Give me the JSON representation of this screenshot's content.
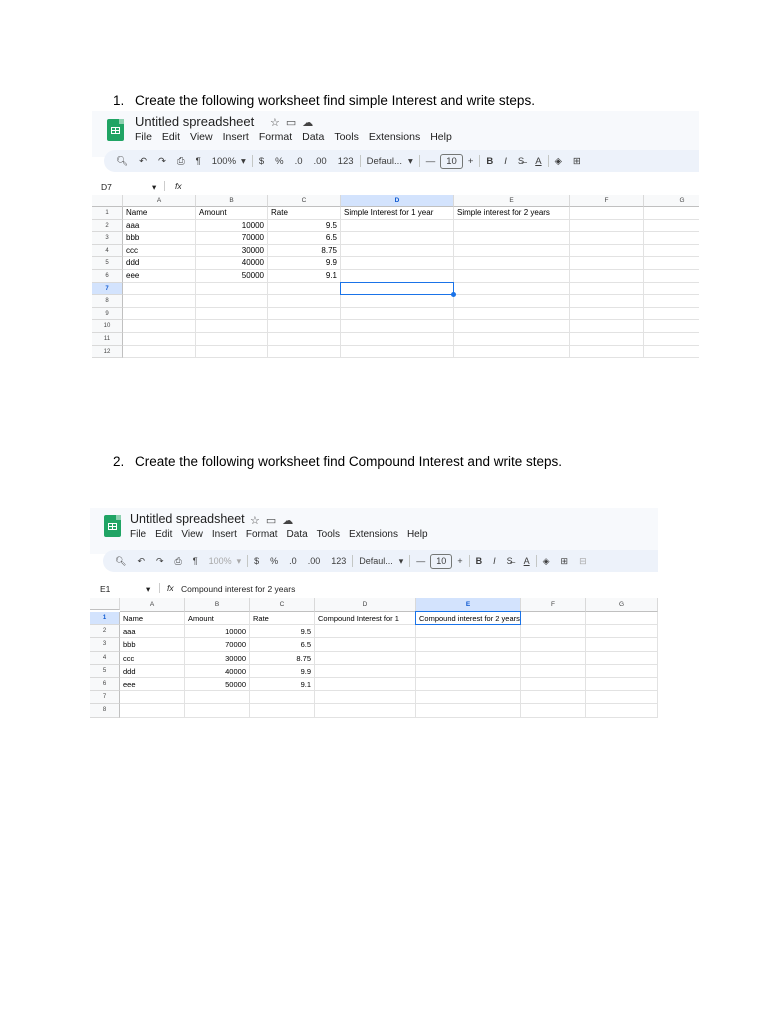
{
  "q1": {
    "number": "1.",
    "text": "Create the following worksheet find simple Interest and write steps."
  },
  "q2": {
    "number": "2.",
    "text": "Create the following worksheet find Compound Interest and write steps."
  },
  "sheet1": {
    "title": "Untitled spreadsheet",
    "menu": [
      "File",
      "Edit",
      "View",
      "Insert",
      "Format",
      "Data",
      "Tools",
      "Extensions",
      "Help"
    ],
    "toolbar": {
      "zoom": "100%",
      "currency": "$",
      "percent": "%",
      "dec_down": ".0",
      "dec_up": ".00",
      "format": "123",
      "font": "Defaul...",
      "size": "10",
      "minus": "—",
      "plus": "+"
    },
    "name_box": "D7",
    "fx": "fx",
    "formula": "",
    "columns": [
      "A",
      "B",
      "C",
      "D",
      "E",
      "F",
      "G"
    ],
    "rows": [
      "1",
      "2",
      "3",
      "4",
      "5",
      "6",
      "7",
      "8",
      "9",
      "10",
      "11",
      "12"
    ],
    "selected_col": "D",
    "selected_row": "7",
    "cells": [
      [
        "Name",
        "Amount",
        "Rate",
        "Simple Interest for 1 year",
        "Simple interest for 2 years",
        "",
        ""
      ],
      [
        "aaa",
        "10000",
        "9.5",
        "",
        "",
        "",
        ""
      ],
      [
        "bbb",
        "70000",
        "6.5",
        "",
        "",
        "",
        ""
      ],
      [
        "ccc",
        "30000",
        "8.75",
        "",
        "",
        "",
        ""
      ],
      [
        "ddd",
        "40000",
        "9.9",
        "",
        "",
        "",
        ""
      ],
      [
        "eee",
        "50000",
        "9.1",
        "",
        "",
        "",
        ""
      ]
    ]
  },
  "sheet2": {
    "title": "Untitled spreadsheet",
    "menu": [
      "File",
      "Edit",
      "View",
      "Insert",
      "Format",
      "Data",
      "Tools",
      "Extensions",
      "Help"
    ],
    "toolbar": {
      "zoom": "100%",
      "currency": "$",
      "percent": "%",
      "dec_down": ".0",
      "dec_up": ".00",
      "format": "123",
      "font": "Defaul...",
      "size": "10",
      "minus": "—",
      "plus": "+"
    },
    "name_box": "E1",
    "fx": "fx",
    "formula": "Compound interest for 2 years",
    "columns": [
      "A",
      "B",
      "C",
      "D",
      "E",
      "F",
      "G"
    ],
    "rows": [
      "1",
      "2",
      "3",
      "4",
      "5",
      "6",
      "7",
      "8"
    ],
    "selected_col": "E",
    "selected_row": "1",
    "cells": [
      [
        "Name",
        "Amount",
        "Rate",
        "Compound  Interest for 1",
        "Compound interest for 2 years",
        "",
        ""
      ],
      [
        "aaa",
        "10000",
        "9.5",
        "",
        "",
        "",
        ""
      ],
      [
        "bbb",
        "70000",
        "6.5",
        "",
        "",
        "",
        ""
      ],
      [
        "ccc",
        "30000",
        "8.75",
        "",
        "",
        "",
        ""
      ],
      [
        "ddd",
        "40000",
        "9.9",
        "",
        "",
        "",
        ""
      ],
      [
        "eee",
        "50000",
        "9.1",
        "",
        "",
        "",
        ""
      ]
    ]
  }
}
